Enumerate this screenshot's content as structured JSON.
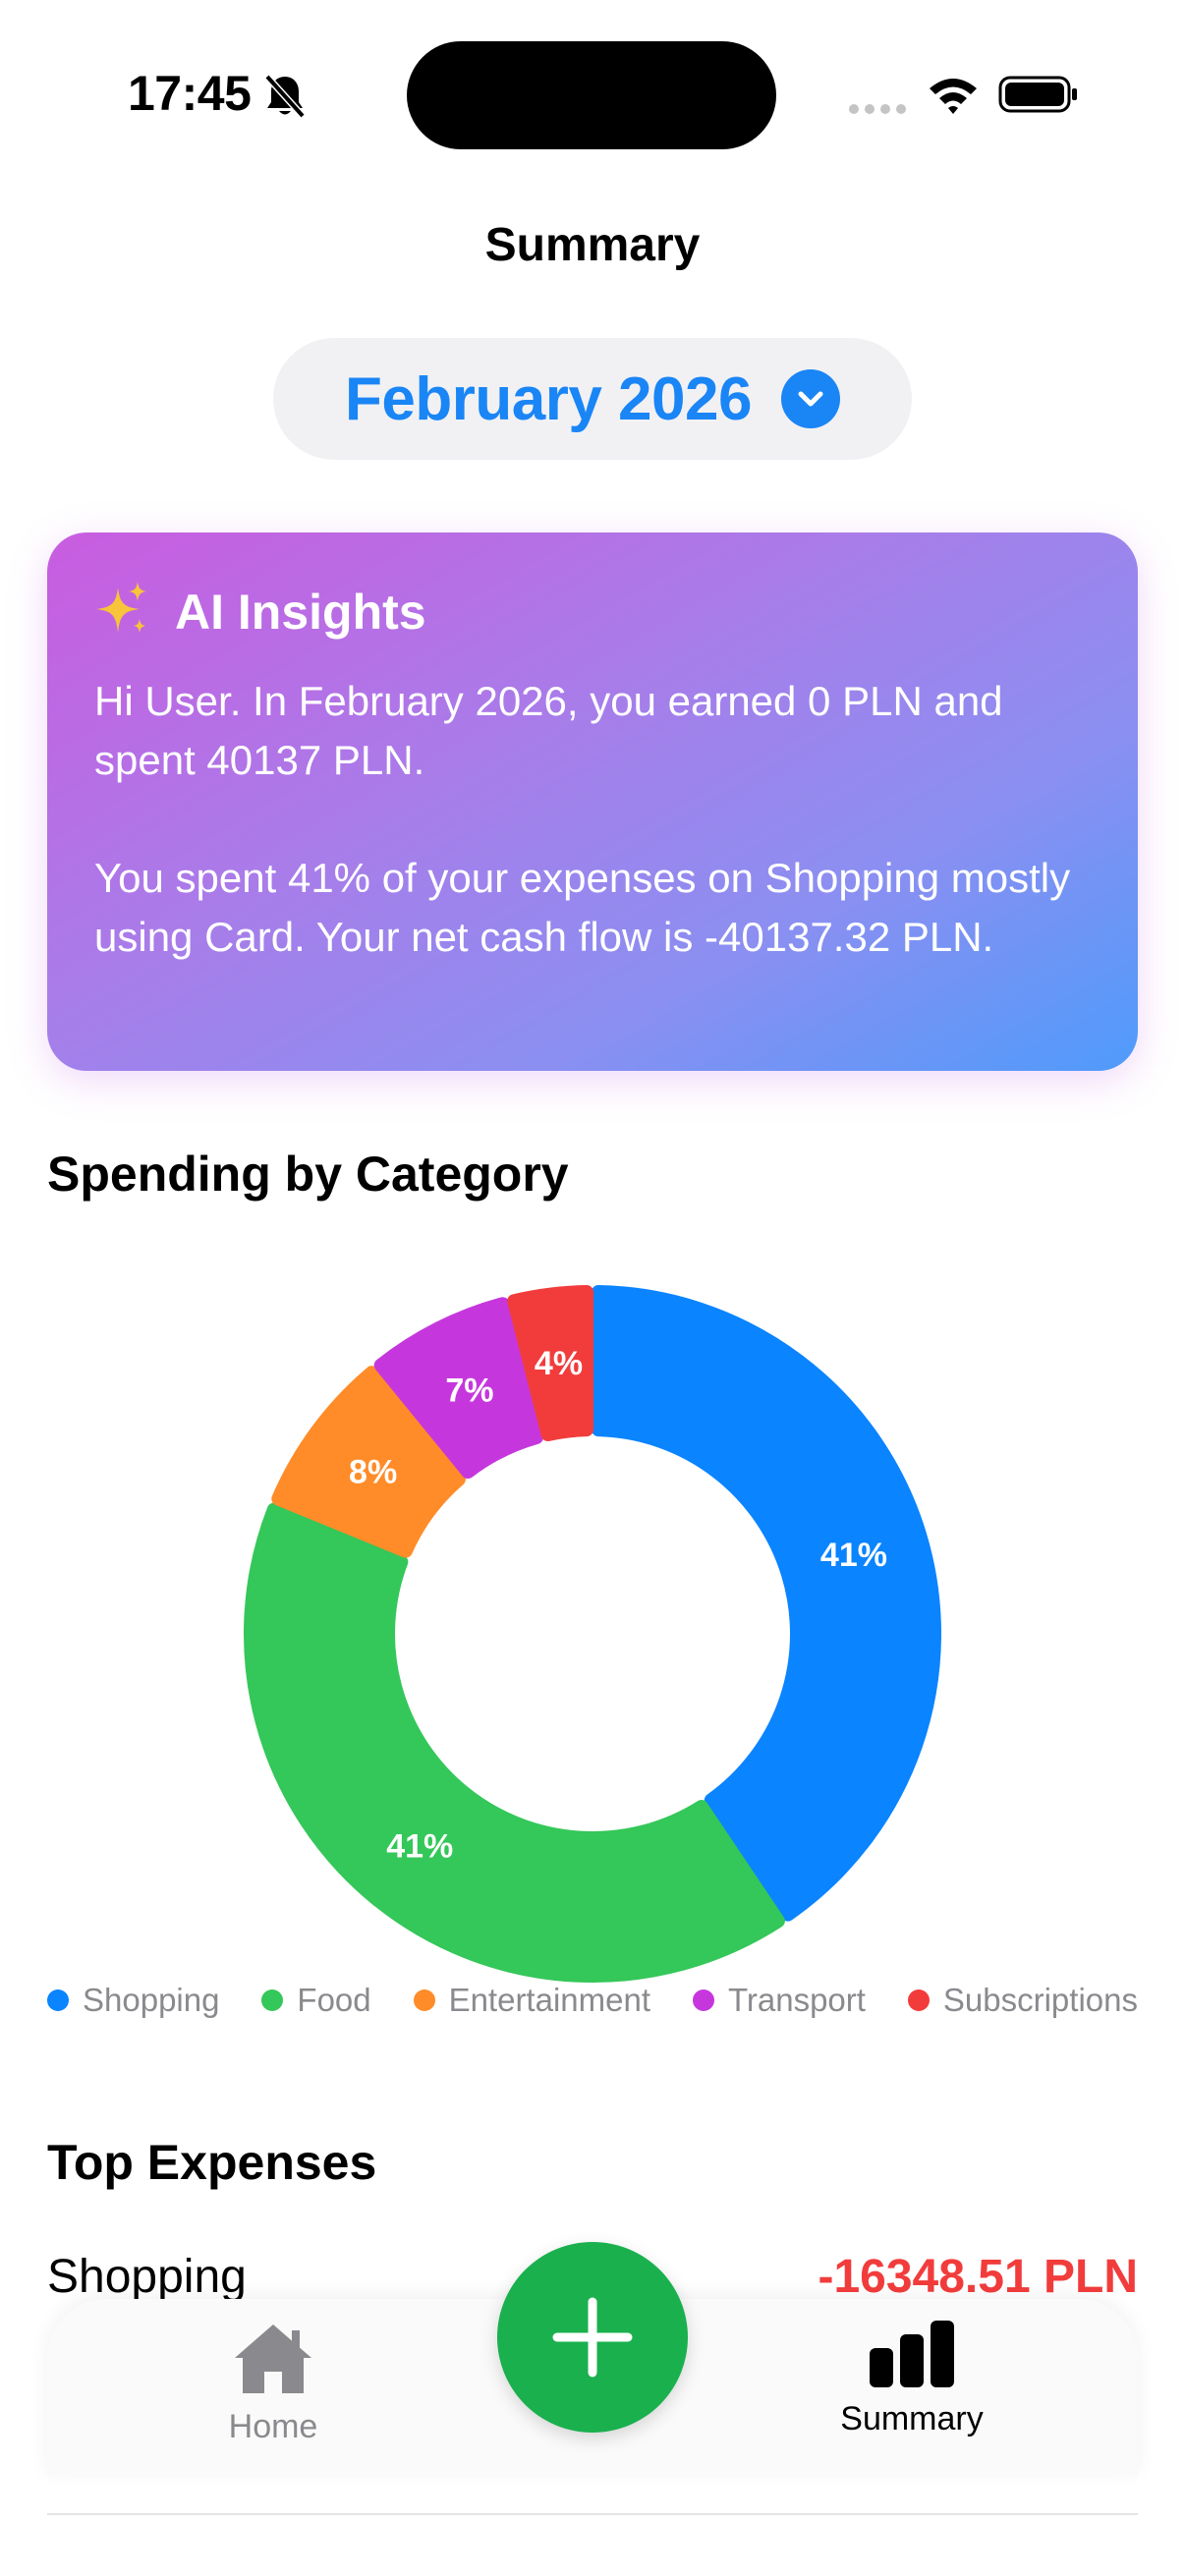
{
  "status_bar": {
    "time": "17:45",
    "icons": [
      "bell-slash-icon",
      "cellular-dots-icon",
      "wifi-icon",
      "battery-icon"
    ]
  },
  "header": {
    "title": "Summary",
    "month_label": "February 2026",
    "month_icon": "chevron-down-circle-icon"
  },
  "ai_insights": {
    "icon": "sparkles-icon",
    "title": "AI Insights",
    "paragraph_1": "Hi User. In February 2026, you earned 0 PLN and spent 40137 PLN.",
    "paragraph_2": "You spent 41% of your expenses on Shopping mostly using Card. Your net cash flow is -40137.32 PLN."
  },
  "spending": {
    "title": "Spending by Category"
  },
  "chart_data": {
    "type": "pie",
    "donut": true,
    "categories": [
      "Shopping",
      "Food",
      "Entertainment",
      "Transport",
      "Subscriptions"
    ],
    "values": [
      41,
      41,
      8,
      7,
      4
    ],
    "labels": [
      "41%",
      "41%",
      "8%",
      "7%",
      "4%"
    ],
    "colors": [
      "#0a84ff",
      "#34c759",
      "#ff8c28",
      "#c537dd",
      "#f23c3c"
    ],
    "legend_position": "bottom"
  },
  "top_expenses": {
    "title": "Top Expenses",
    "items": [
      {
        "name": "Shopping",
        "amount": "-16348.51 PLN"
      }
    ]
  },
  "tab_bar": {
    "home_label": "Home",
    "home_icon": "house-icon",
    "summary_label": "Summary",
    "summary_icon": "bar-chart-icon",
    "add_icon": "plus-icon",
    "active": "Summary"
  },
  "colors": {
    "accent": "#1a85f5",
    "fab": "#1ab04e",
    "negative": "#f23c3c",
    "pill_bg": "#f1f1f4"
  }
}
